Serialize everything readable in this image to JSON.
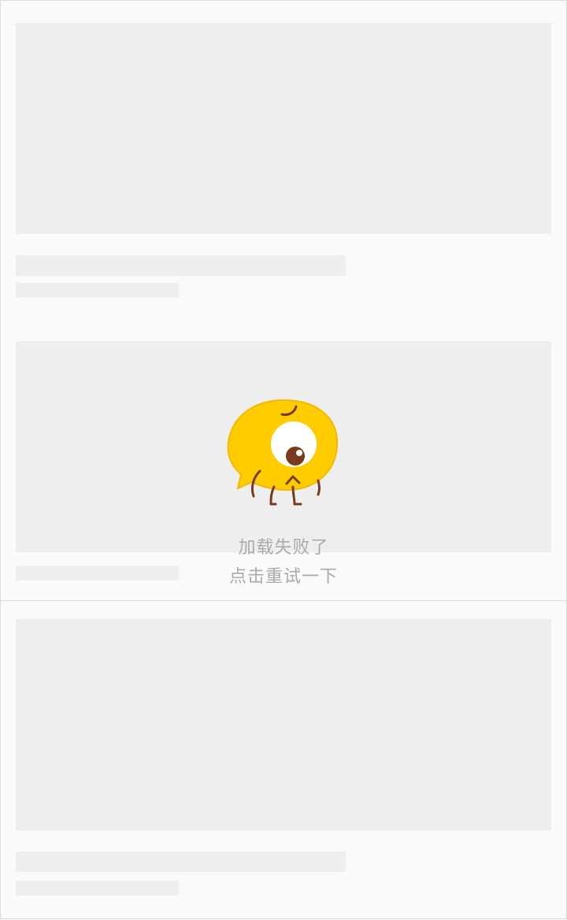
{
  "error_state": {
    "message": "加载失败了",
    "retry_text": "点击重试一下",
    "mascot_icon": "sad-one-eyed-blob-icon"
  },
  "colors": {
    "background": "#fafafa",
    "placeholder": "#eeeeee",
    "border": "#dcdcdc",
    "error_text": "#aaaaaa",
    "mascot_body": "#ffcc00",
    "mascot_outline": "#f5b800",
    "mascot_limbs": "#7a3a1e"
  }
}
